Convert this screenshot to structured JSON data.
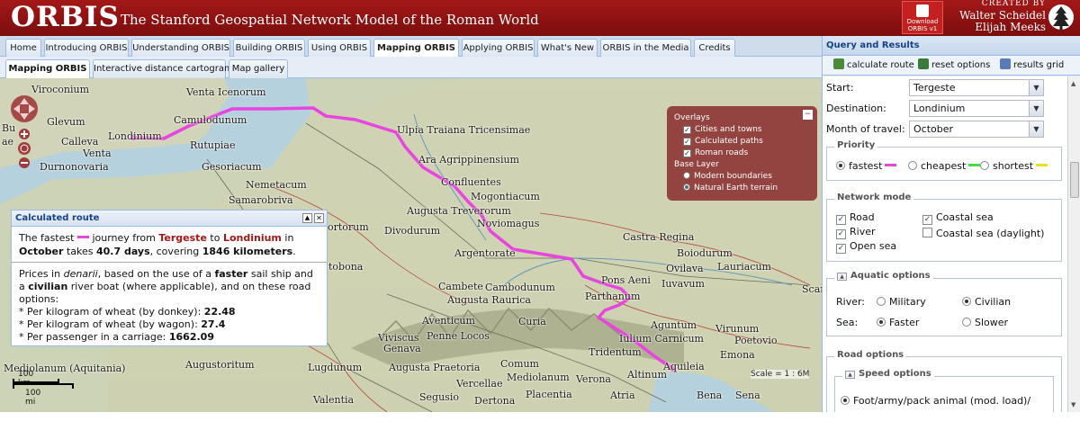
{
  "header": {
    "logo": "ORBIS",
    "tagline": "The Stanford Geospatial Network Model of the Roman World",
    "download_line1": "Download",
    "download_line2": "ORBIS v1",
    "created_by": "CREATED BY",
    "author1": "Walter Scheidel",
    "author2": "Elijah Meeks"
  },
  "tabs": [
    "Home",
    "Introducing ORBIS",
    "Understanding ORBIS",
    "Building ORBIS",
    "Using ORBIS",
    "Mapping ORBIS",
    "Applying ORBIS",
    "What's New",
    "ORBIS in the Media",
    "Credits"
  ],
  "subtabs": [
    "Mapping ORBIS",
    "Interactive distance cartogram",
    "Map gallery"
  ],
  "map": {
    "places": [
      "Viroconium",
      "Venta Icenorum",
      "Glevum",
      "Camulodunum",
      "Londinium",
      "Calleva",
      "Rutupiae",
      "Venta",
      "Durnonovaria",
      "Gesoriacum",
      "Nemetacum",
      "Samarobriva",
      "Ulpia Traiana Tricensimae",
      "Ara Agrippinensium",
      "Confluentes",
      "Mogontiacum",
      "Augusta Treverorum",
      "Noviomagus",
      "Divodurum",
      "Argentorate",
      "Castra Regina",
      "Boiodurum",
      "Ovilava",
      "Lauriacum",
      "Pons Aeni",
      "Iuvavum",
      "Parthanum",
      "Cambete",
      "Cambodunum",
      "Augusta Raurica",
      "Aventicum",
      "Curia",
      "Viviscus",
      "Penne Locos",
      "Genava",
      "Tridentum",
      "Iulium Carnicum",
      "Aguntum",
      "Virunum",
      "Poetovio",
      "Emona",
      "Aquileia",
      "Augustoritum",
      "Lugdunum",
      "Augusta Praetoria",
      "Comum",
      "Mediolanum",
      "Verona",
      "Altinum",
      "Vercellae",
      "Segusio",
      "Dertona",
      "Placentia",
      "Atria",
      "Valentia",
      "Mediolanum (Aquitania)",
      "Bena",
      "Sena",
      "Scar",
      "Bu",
      "ae",
      "ortorum",
      "tobona"
    ],
    "scale_km": "100 km",
    "scale_mi": "100 mi",
    "scale_text": "Scale = 1 : 6M"
  },
  "overlays": {
    "title": "Overlays",
    "items": [
      {
        "label": "Cities and towns",
        "checked": true
      },
      {
        "label": "Calculated paths",
        "checked": true
      },
      {
        "label": "Roman roads",
        "checked": true
      }
    ],
    "base_title": "Base Layer",
    "base_items": [
      {
        "label": "Modern boundaries",
        "selected": false
      },
      {
        "label": "Natural Earth terrain",
        "selected": true
      }
    ]
  },
  "route": {
    "title": "Calculated route",
    "s1_a": "The fastest",
    "s1_b": "journey from",
    "from": "Tergeste",
    "s1_c": "to",
    "to": "Londinium",
    "s1_d": "in",
    "month": "October",
    "s1_e": "takes",
    "days": "40.7 days",
    "s1_f": ", covering",
    "km": "1846 kilometers",
    "s1_g": ".",
    "s2_a": "Prices in",
    "currency": "denarii",
    "s2_b": ", based on the use of a",
    "ship": "faster",
    "s2_c": "sail ship and a",
    "boat": "civilian",
    "s2_d": "river boat (where applicable), and on these road options:",
    "p1_label": "* Per kilogram of wheat (by donkey):",
    "p1_value": "22.48",
    "p2_label": "* Per kilogram of wheat (by wagon):",
    "p2_value": "27.4",
    "p3_label": "* Per passenger in a carriage:",
    "p3_value": "1662.09"
  },
  "panel": {
    "title": "Query and Results",
    "calc_btn": "calculate route",
    "reset_btn": "reset options",
    "grid_btn": "results grid",
    "start_label": "Start:",
    "start_value": "Tergeste",
    "dest_label": "Destination:",
    "dest_value": "Londinium",
    "month_label": "Month of travel:",
    "month_value": "October",
    "priority_title": "Priority",
    "priority": [
      {
        "label": "fastest",
        "color": "#e844e0",
        "selected": true
      },
      {
        "label": "cheapest",
        "color": "#44dd44",
        "selected": false
      },
      {
        "label": "shortest",
        "color": "#e8e020",
        "selected": false
      }
    ],
    "network_title": "Network mode",
    "network": [
      {
        "label": "Road",
        "checked": true
      },
      {
        "label": "River",
        "checked": true
      },
      {
        "label": "Open sea",
        "checked": true
      },
      {
        "label": "Coastal sea",
        "checked": true
      },
      {
        "label": "Coastal sea (daylight)",
        "checked": false
      }
    ],
    "aquatic_title": "Aquatic options",
    "river_label": "River:",
    "river_opts": [
      {
        "label": "Military",
        "selected": false
      },
      {
        "label": "Civilian",
        "selected": true
      }
    ],
    "sea_label": "Sea:",
    "sea_opts": [
      {
        "label": "Faster",
        "selected": true
      },
      {
        "label": "Slower",
        "selected": false
      }
    ],
    "road_title": "Road options",
    "speed_title": "Speed options",
    "speed_first": "Foot/army/pack animal (mod. load)/"
  }
}
